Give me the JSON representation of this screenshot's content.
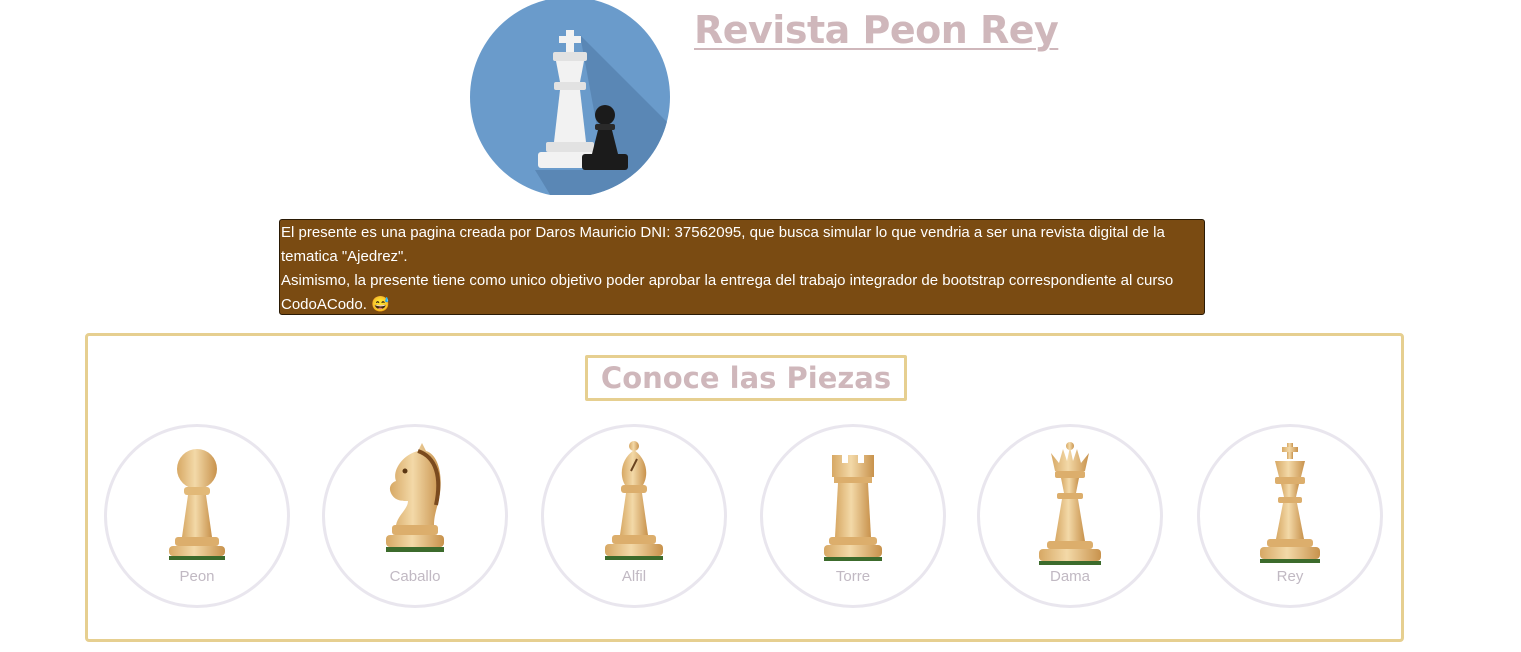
{
  "header": {
    "title": "Revista Peon Rey",
    "logo_icon": "king-and-pawn-logo-icon",
    "logo_colors": {
      "background": "#6a9bcb",
      "shadow": "#5a87b5",
      "king": "#f2f2f2",
      "pawn": "#1b1b1b"
    }
  },
  "intro": {
    "line1": "El presente es una pagina creada por Daros Mauricio DNI: 37562095, que busca simular lo que vendria a ser una revista digital de la tematica \"Ajedrez\".",
    "line2": "Asimismo, la presente tiene como unico objetivo poder aprobar la entrega del trabajo integrador de bootstrap correspondiente al curso CodoACodo. 😅",
    "background": "#7a4b12"
  },
  "pieces_section": {
    "title": "Conoce las Piezas",
    "border_color": "#e6cf90",
    "items": [
      {
        "label": "Peon",
        "icon": "pawn-icon"
      },
      {
        "label": "Caballo",
        "icon": "knight-icon"
      },
      {
        "label": "Alfil",
        "icon": "bishop-icon"
      },
      {
        "label": "Torre",
        "icon": "rook-icon"
      },
      {
        "label": "Dama",
        "icon": "queen-icon"
      },
      {
        "label": "Rey",
        "icon": "king-icon"
      }
    ]
  }
}
